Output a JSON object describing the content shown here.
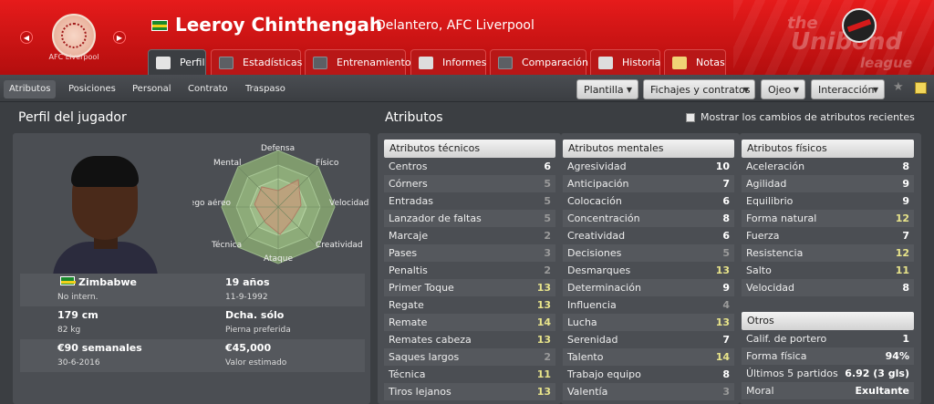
{
  "header": {
    "club_badge_text": "AFC Liverpool",
    "player_name": "Leeroy Chinthengah",
    "player_subtitle": "Delantero, AFC Liverpool",
    "logo_line1": "the",
    "logo_line2": "Unibond",
    "logo_line3": "league"
  },
  "tabs": [
    {
      "label": "Perfil",
      "active": true
    },
    {
      "label": "Estadísticas",
      "active": false
    },
    {
      "label": "Entrenamiento",
      "active": false
    },
    {
      "label": "Informes",
      "active": false
    },
    {
      "label": "Comparación",
      "active": false
    },
    {
      "label": "Historia",
      "active": false
    },
    {
      "label": "Notas",
      "active": false
    }
  ],
  "subnav": {
    "items": [
      "Atributos",
      "Posiciones",
      "Personal",
      "Contrato",
      "Traspaso"
    ],
    "dropdowns": [
      "Plantilla",
      "Fichajes y contratos",
      "Ojeo",
      "Interacción"
    ]
  },
  "profile": {
    "title": "Perfil del jugador",
    "radar_labels": {
      "defensa": "Defensa",
      "fisico": "Físico",
      "velocidad": "Velocidad",
      "creatividad": "Creatividad",
      "ataque": "Ataque",
      "tecnica": "Técnica",
      "juego_aereo": "Juego aéreo",
      "mental": "Mental"
    },
    "nationality": "Zimbabwe",
    "international": "No intern.",
    "age": "19 años",
    "birth_date": "11-9-1992",
    "height": "179 cm",
    "weight": "82 kg",
    "foot": "Dcha. sólo",
    "foot_label": "Pierna preferida",
    "wage": "€90 semanales",
    "contract_end": "30-6-2016",
    "value": "€45,000",
    "value_label": "Valor estimado"
  },
  "attributes": {
    "title": "Atributos",
    "show_changes_label": "Mostrar los cambios de atributos recientes",
    "technical_header": "Atributos técnicos",
    "mental_header": "Atributos mentales",
    "physical_header": "Atributos físicos",
    "others_header": "Otros",
    "technical": [
      {
        "name": "Centros",
        "value": "6"
      },
      {
        "name": "Córners",
        "value": "5"
      },
      {
        "name": "Entradas",
        "value": "5"
      },
      {
        "name": "Lanzador de faltas",
        "value": "5"
      },
      {
        "name": "Marcaje",
        "value": "2"
      },
      {
        "name": "Pases",
        "value": "3"
      },
      {
        "name": "Penaltis",
        "value": "2"
      },
      {
        "name": "Primer Toque",
        "value": "13"
      },
      {
        "name": "Regate",
        "value": "13"
      },
      {
        "name": "Remate",
        "value": "14"
      },
      {
        "name": "Remates cabeza",
        "value": "13"
      },
      {
        "name": "Saques largos",
        "value": "2"
      },
      {
        "name": "Técnica",
        "value": "11"
      },
      {
        "name": "Tiros lejanos",
        "value": "13"
      }
    ],
    "mental": [
      {
        "name": "Agresividad",
        "value": "10"
      },
      {
        "name": "Anticipación",
        "value": "7"
      },
      {
        "name": "Colocación",
        "value": "6"
      },
      {
        "name": "Concentración",
        "value": "8"
      },
      {
        "name": "Creatividad",
        "value": "6"
      },
      {
        "name": "Decisiones",
        "value": "5"
      },
      {
        "name": "Desmarques",
        "value": "13"
      },
      {
        "name": "Determinación",
        "value": "9"
      },
      {
        "name": "Influencia",
        "value": "4"
      },
      {
        "name": "Lucha",
        "value": "13"
      },
      {
        "name": "Serenidad",
        "value": "7"
      },
      {
        "name": "Talento",
        "value": "14"
      },
      {
        "name": "Trabajo equipo",
        "value": "8"
      },
      {
        "name": "Valentía",
        "value": "3"
      }
    ],
    "physical": [
      {
        "name": "Aceleración",
        "value": "8"
      },
      {
        "name": "Agilidad",
        "value": "9"
      },
      {
        "name": "Equilibrio",
        "value": "9"
      },
      {
        "name": "Forma natural",
        "value": "12"
      },
      {
        "name": "Fuerza",
        "value": "7"
      },
      {
        "name": "Resistencia",
        "value": "12"
      },
      {
        "name": "Salto",
        "value": "11"
      },
      {
        "name": "Velocidad",
        "value": "8"
      }
    ],
    "others": [
      {
        "name": "Calif. de portero",
        "value": "1"
      },
      {
        "name": "Forma física",
        "value": "94%"
      },
      {
        "name": "Últimos 5 partidos",
        "value": "6.92 (3 gls)"
      },
      {
        "name": "Moral",
        "value": "Exultante"
      }
    ]
  },
  "colors": {
    "header_red": "#d41414",
    "panel": "#4b4e53",
    "highlight_value": "#e8e48a",
    "radar_fill": "#a7c98a"
  }
}
